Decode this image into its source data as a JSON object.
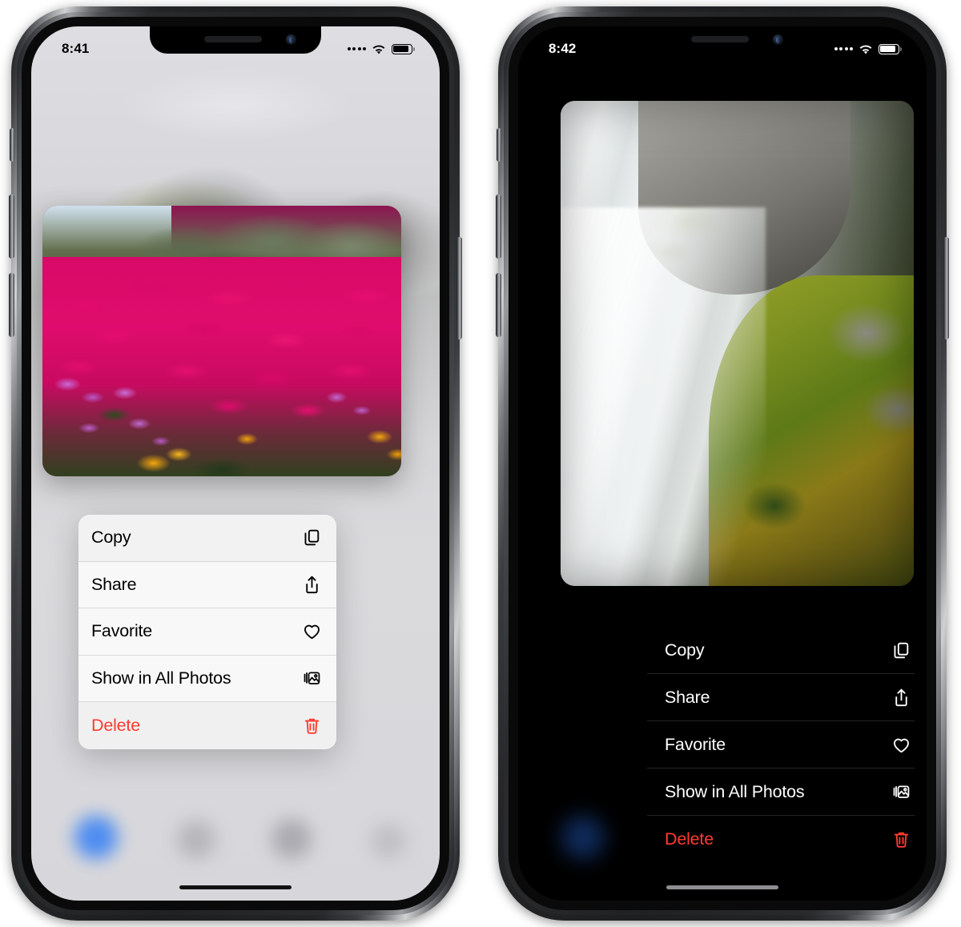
{
  "page": {
    "title": "iOS Photos context menu — light and dark appearance",
    "accent_blue": "#2f7cf6",
    "destructive_red": "#ff3b30"
  },
  "phones": [
    {
      "id": "left",
      "appearance": "light",
      "status_bar": {
        "time": "8:41",
        "cellular_icon": "cellular-dots-icon",
        "wifi_icon": "wifi-icon",
        "battery_icon": "battery-full-icon"
      },
      "photo": {
        "name": "photo-flowers",
        "alt": "Magenta and orange ice plant flowers"
      },
      "context_menu": {
        "name": "context-menu-light",
        "items": [
          {
            "label": "Copy",
            "icon": "copy-icon",
            "destructive": false
          },
          {
            "label": "Share",
            "icon": "share-icon",
            "destructive": false
          },
          {
            "label": "Favorite",
            "icon": "heart-icon",
            "destructive": false
          },
          {
            "label": "Show in All Photos",
            "icon": "photos-stack-icon",
            "destructive": false
          },
          {
            "label": "Delete",
            "icon": "trash-icon",
            "destructive": true
          }
        ]
      },
      "tab_bar": {
        "name": "tab-bar-blurred",
        "items": [
          "library-tab",
          "for-you-tab",
          "albums-tab",
          "search-tab"
        ],
        "selected_index": 0
      },
      "home_indicator": "home-indicator"
    },
    {
      "id": "right",
      "appearance": "dark",
      "status_bar": {
        "time": "8:42",
        "cellular_icon": "cellular-dots-icon",
        "wifi_icon": "wifi-icon",
        "battery_icon": "battery-full-icon"
      },
      "photo": {
        "name": "photo-waterfall",
        "alt": "Long-exposure waterfall over mossy rocks"
      },
      "context_menu": {
        "name": "context-menu-dark",
        "items": [
          {
            "label": "Copy",
            "icon": "copy-icon",
            "destructive": false
          },
          {
            "label": "Share",
            "icon": "share-icon",
            "destructive": false
          },
          {
            "label": "Favorite",
            "icon": "heart-icon",
            "destructive": false
          },
          {
            "label": "Show in All Photos",
            "icon": "photos-stack-icon",
            "destructive": false
          },
          {
            "label": "Delete",
            "icon": "trash-icon",
            "destructive": true
          }
        ]
      },
      "tab_bar": {
        "name": "tab-bar-blurred",
        "items": [
          "library-tab"
        ],
        "selected_index": 0
      },
      "home_indicator": "home-indicator"
    }
  ]
}
